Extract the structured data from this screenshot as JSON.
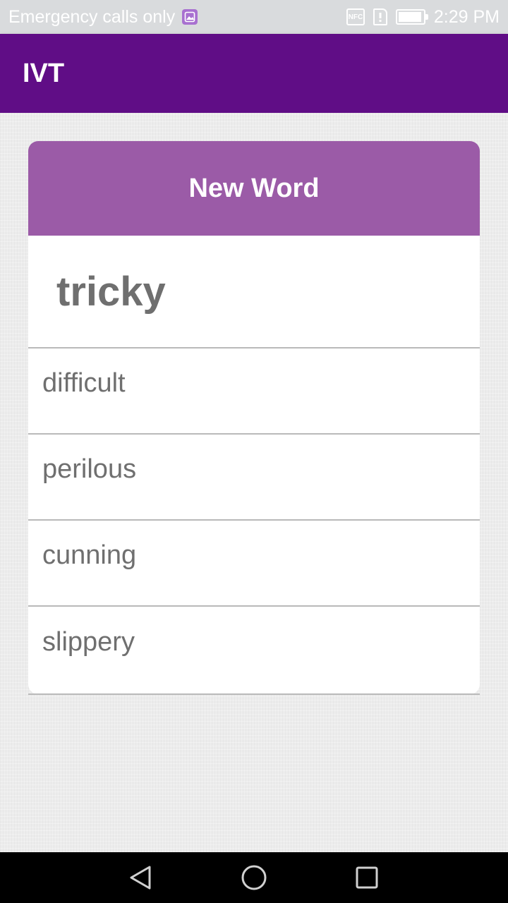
{
  "status_bar": {
    "carrier_text": "Emergency calls only",
    "time": "2:29 PM",
    "icons": [
      "image-notification-icon",
      "nfc-icon",
      "sim-alert-icon",
      "battery-icon"
    ],
    "nfc_label": "NFC",
    "battery_level": 0.95
  },
  "app_bar": {
    "title": "IVT",
    "color": "#600d86"
  },
  "card": {
    "header_title": "New Word",
    "header_color": "#9b5ba7",
    "word": "tricky",
    "options": [
      {
        "label": "difficult"
      },
      {
        "label": "perilous"
      },
      {
        "label": "cunning"
      },
      {
        "label": "slippery"
      }
    ]
  },
  "nav_bar": {
    "buttons": [
      "back-icon",
      "home-icon",
      "recents-icon"
    ]
  }
}
